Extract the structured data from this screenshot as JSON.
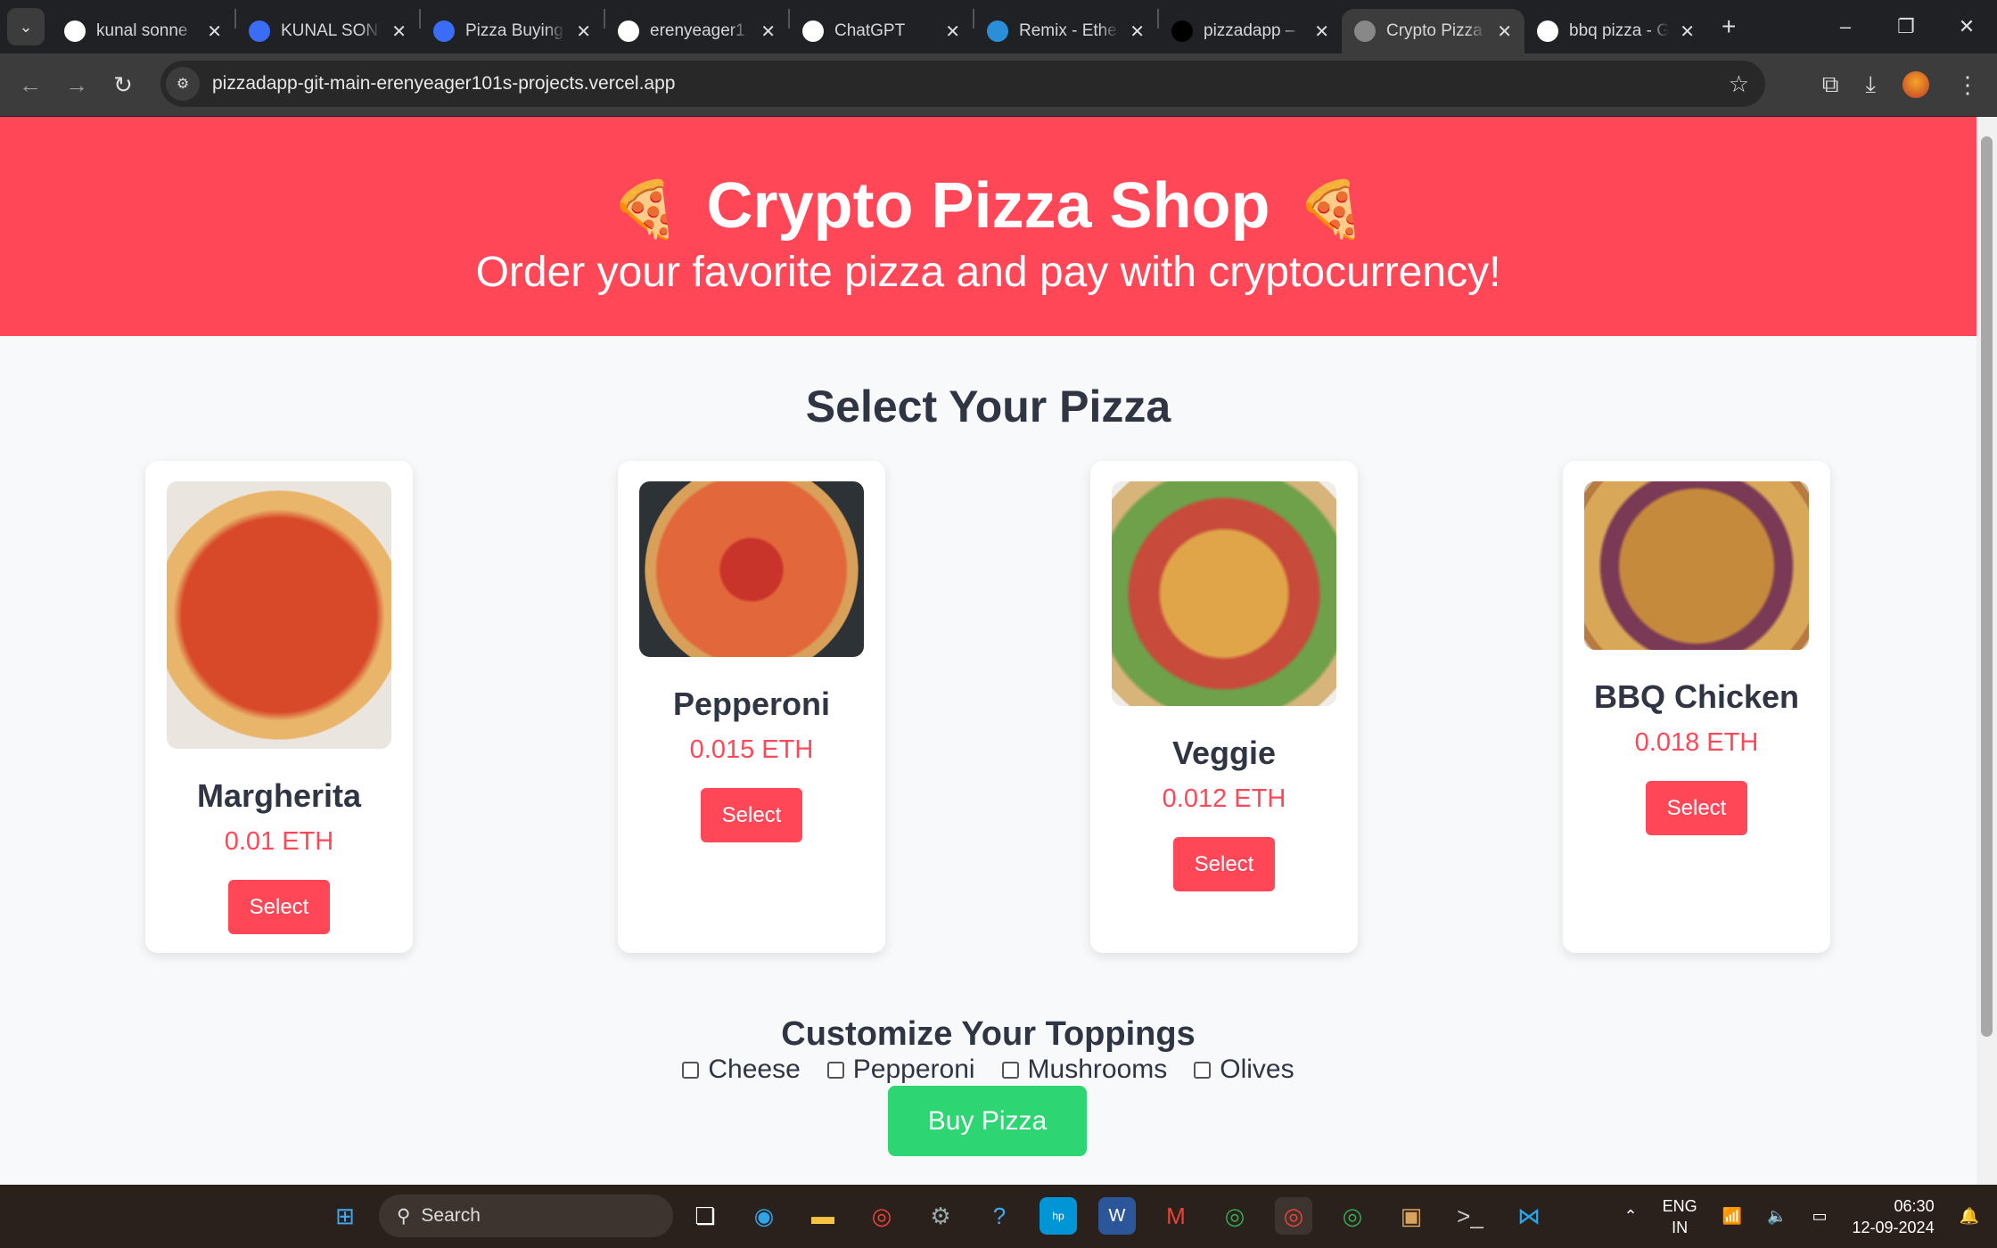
{
  "browser": {
    "tabs": [
      {
        "label": "kunal sonne",
        "icon": "google-icon",
        "color": "#fff",
        "active": false
      },
      {
        "label": "KUNAL SONI",
        "icon": "doc-icon",
        "color": "#3b6cf6",
        "active": false
      },
      {
        "label": "Pizza Buying",
        "icon": "doc-icon",
        "color": "#3b6cf6",
        "active": false
      },
      {
        "label": "erenyeager1",
        "icon": "github-icon",
        "color": "#fff",
        "active": false
      },
      {
        "label": "ChatGPT",
        "icon": "chatgpt-icon",
        "color": "#fff",
        "active": false
      },
      {
        "label": "Remix - Ethe",
        "icon": "remix-icon",
        "color": "#2a8fd6",
        "active": false
      },
      {
        "label": "pizzadapp –",
        "icon": "vercel-icon",
        "color": "#000",
        "active": false
      },
      {
        "label": "Crypto Pizza",
        "icon": "globe-icon",
        "color": "#888",
        "active": true
      },
      {
        "label": "bbq pizza - G",
        "icon": "google-icon",
        "color": "#fff",
        "active": false
      }
    ],
    "url": "pizzadapp-git-main-erenyeager101s-projects.vercel.app"
  },
  "header": {
    "title": "Crypto Pizza Shop",
    "subtitle": "Order your favorite pizza and pay with cryptocurrency!",
    "emoji": "🍕"
  },
  "menu": {
    "title": "Select Your Pizza",
    "pizzas": [
      {
        "name": "Margherita",
        "price": "0.01 ETH",
        "button": "Select"
      },
      {
        "name": "Pepperoni",
        "price": "0.015 ETH",
        "button": "Select"
      },
      {
        "name": "Veggie",
        "price": "0.012 ETH",
        "button": "Select"
      },
      {
        "name": "BBQ Chicken",
        "price": "0.018 ETH",
        "button": "Select"
      }
    ]
  },
  "toppings": {
    "title": "Customize Your Toppings",
    "items": [
      "Cheese",
      "Pepperoni",
      "Mushrooms",
      "Olives"
    ]
  },
  "buy_button": "Buy Pizza",
  "taskbar": {
    "search": "Search",
    "lang": "ENG",
    "region": "IN",
    "time": "06:30",
    "date": "12-09-2024"
  },
  "colors": {
    "accent": "#ff4757",
    "buy": "#2ed573"
  }
}
